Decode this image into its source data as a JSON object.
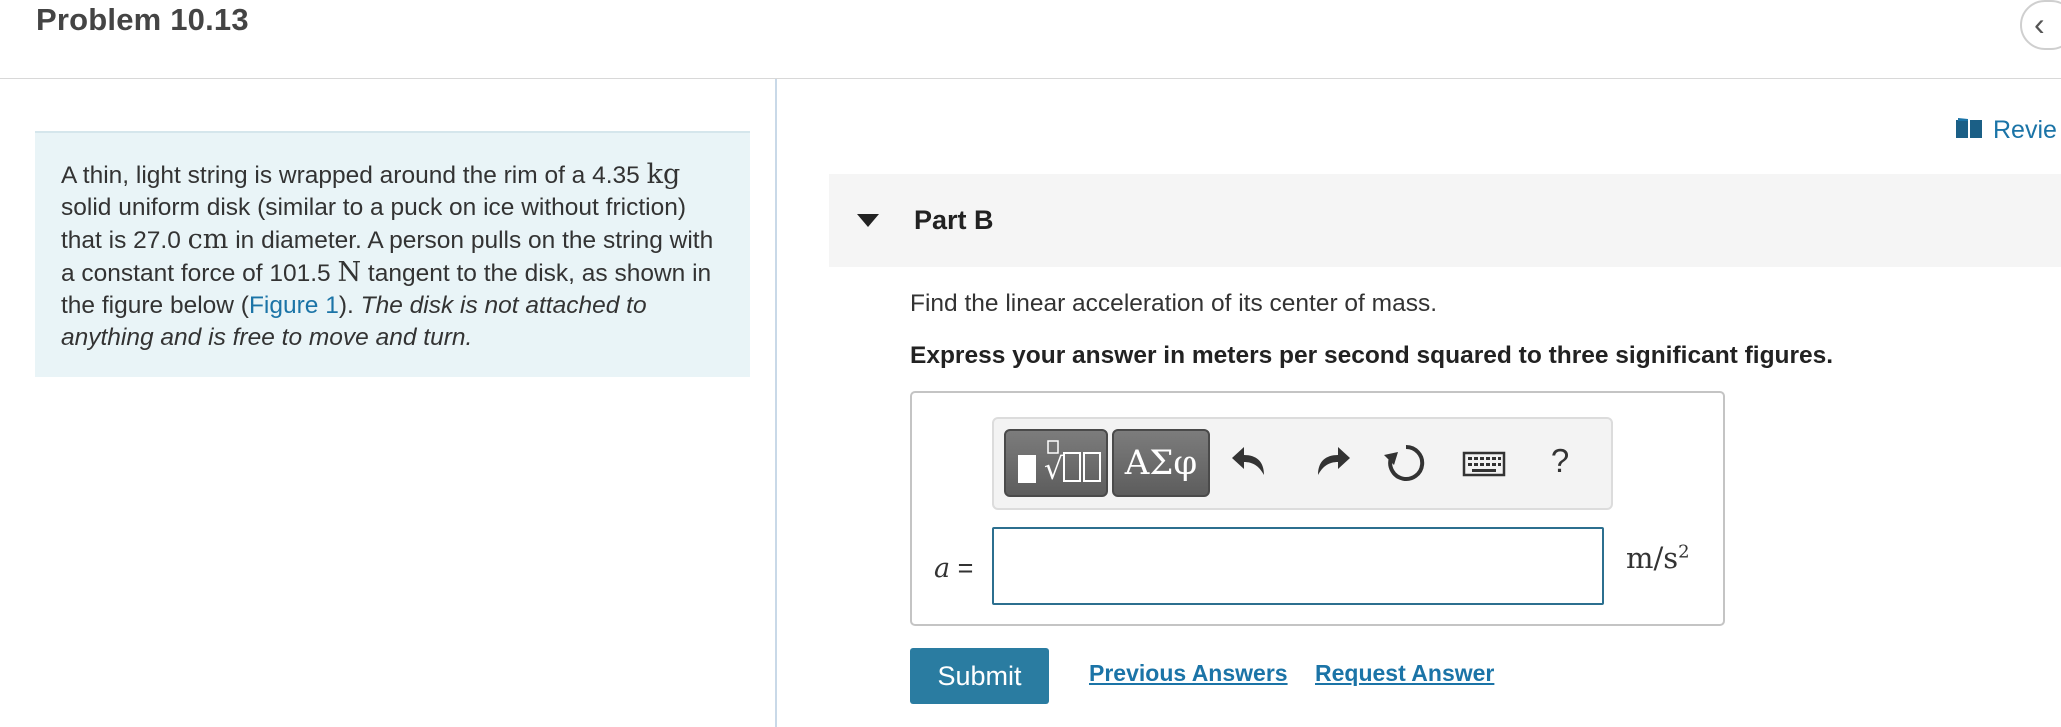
{
  "header": {
    "problem_title": "Problem 10.13",
    "collapse_icon": "chevron-left-icon"
  },
  "statement": {
    "text_1": "A thin, light string is wrapped around the rim of a 4.35 ",
    "unit_mass": "kg",
    "text_2": " solid uniform disk (similar to a puck on ice without friction) that is 27.0 ",
    "unit_length": "cm",
    "text_3": " in diameter. A person pulls on the string with a constant force of 101.5 ",
    "unit_force": "N",
    "text_4": " tangent to the disk, as shown in the figure below (",
    "figure_link": "Figure 1",
    "text_5": "). ",
    "italic_text": "The disk is not attached to anything and is free to move and turn."
  },
  "review_link": {
    "label": "Revie",
    "icon": "book-icon"
  },
  "part": {
    "label": "Part B",
    "toggle_icon": "caret-down-icon",
    "question": "Find the linear acceleration of its center of mass.",
    "instruction": "Express your answer in meters per second squared to three significant figures."
  },
  "toolbar": {
    "templates_icon": "templates-icon",
    "symbols_label": "ΑΣφ",
    "undo_icon": "undo-icon",
    "redo_icon": "redo-icon",
    "reset_icon": "reset-icon",
    "keyboard_icon": "keyboard-icon",
    "help_label": "?"
  },
  "answer": {
    "variable": "a",
    "equals": " =",
    "value": "",
    "unit_base": "m/s",
    "unit_exp": "2"
  },
  "actions": {
    "submit_label": "Submit",
    "previous_answers": "Previous Answers",
    "request_answer": "Request Answer"
  },
  "colors": {
    "accent": "#2a7ca1",
    "link": "#1b74a7",
    "statement_bg": "#e9f4f7"
  }
}
